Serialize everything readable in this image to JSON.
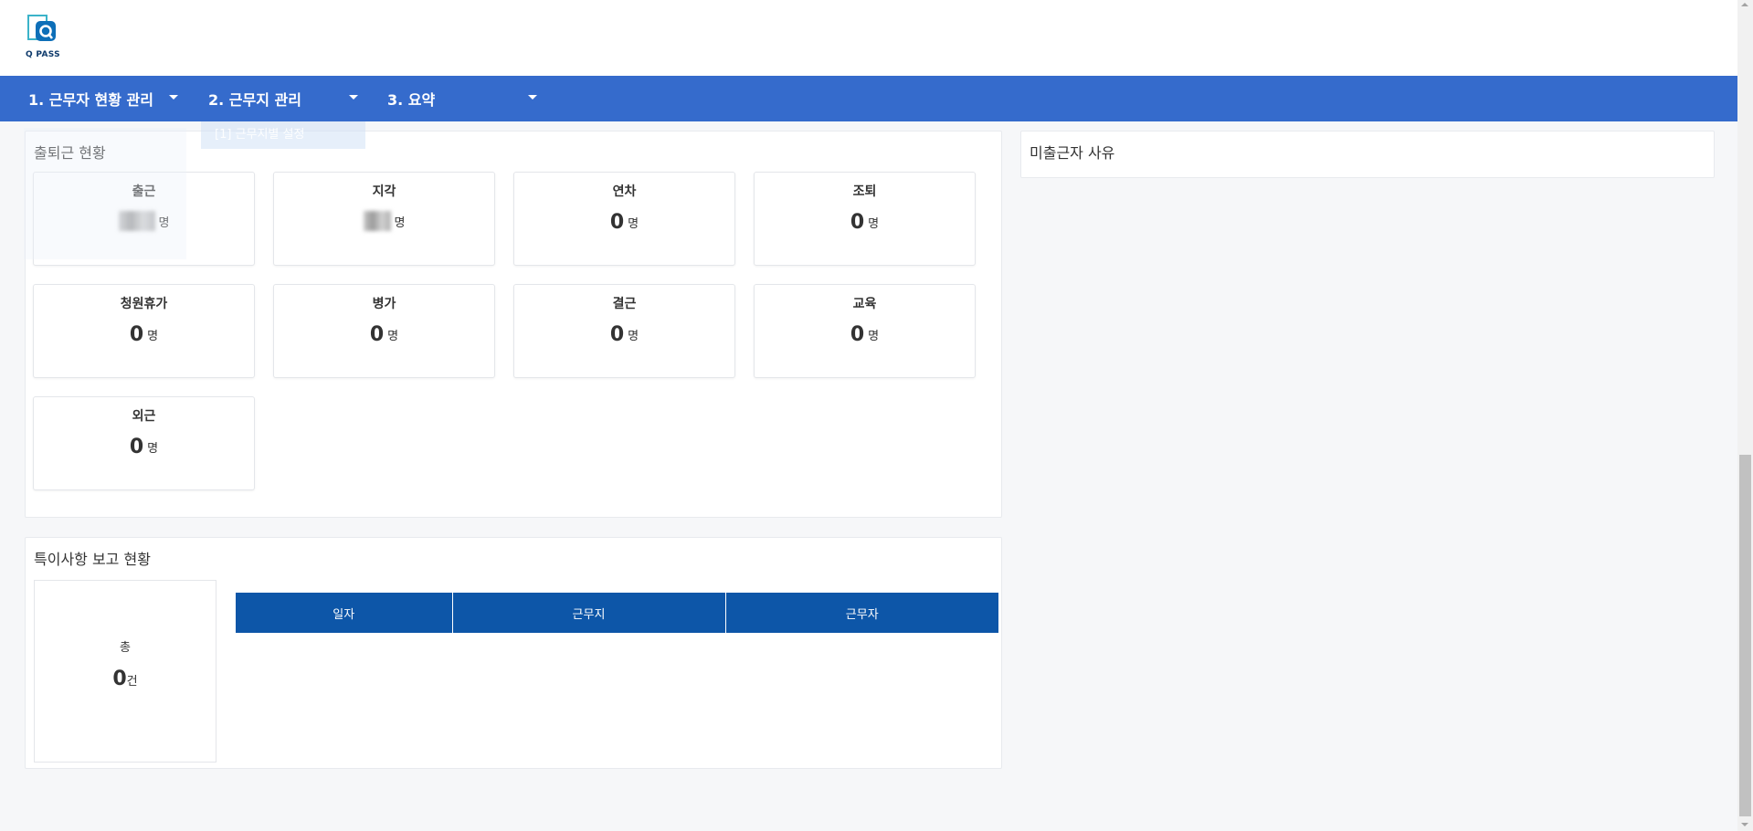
{
  "app": {
    "logo_text": "Q PASS",
    "brand_color": "#356bcc"
  },
  "nav": {
    "items": [
      {
        "label": "1. 근무자 현황 관리"
      },
      {
        "label": "2. 근무지 관리"
      },
      {
        "label": "3. 요약"
      }
    ],
    "dropdown_ghost": "[1] 근무지별 설정"
  },
  "attendance": {
    "title": "출퇴근 현황",
    "cards": [
      {
        "label": "출근",
        "value": "",
        "unit": "명",
        "redacted": true
      },
      {
        "label": "지각",
        "value": "",
        "unit": "명",
        "redacted": true
      },
      {
        "label": "연차",
        "value": "0",
        "unit": "명"
      },
      {
        "label": "조퇴",
        "value": "0",
        "unit": "명"
      },
      {
        "label": "청원휴가",
        "value": "0",
        "unit": "명"
      },
      {
        "label": "병가",
        "value": "0",
        "unit": "명"
      },
      {
        "label": "결근",
        "value": "0",
        "unit": "명"
      },
      {
        "label": "교육",
        "value": "0",
        "unit": "명"
      },
      {
        "label": "외근",
        "value": "0",
        "unit": "명"
      }
    ]
  },
  "absence": {
    "title": "미출근자 사유"
  },
  "report": {
    "title": "특이사항 보고 현황",
    "total_label": "총",
    "total_value": "0",
    "total_unit": "건",
    "columns": [
      "일자",
      "근무지",
      "근무자"
    ],
    "header_color": "#0d56a8"
  }
}
